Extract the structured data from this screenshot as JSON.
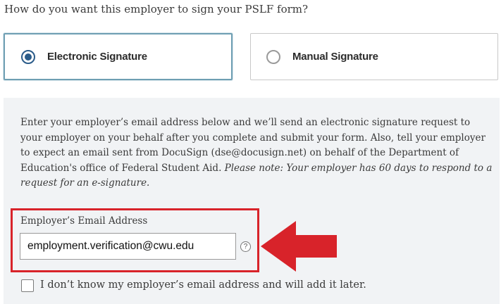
{
  "question": "How do you want this employer to sign your PSLF form?",
  "signature_options": [
    {
      "label": "Electronic Signature",
      "selected": true
    },
    {
      "label": "Manual Signature",
      "selected": false
    }
  ],
  "instructions": {
    "text": "Enter your employer’s email address below and we’ll send an electronic signature request to your employer on your behalf after you complete and submit your form. Also, tell your employer to expect an email sent from DocuSign (dse@docusign.net) on behalf of the Department of Education's office of Federal Student Aid. ",
    "note": "Please note: Your employer has 60 days to respond to a request for an e-signature."
  },
  "email_field": {
    "label": "Employer’s Email Address",
    "value": "employment.verification@cwu.edu",
    "help_glyph": "?"
  },
  "no_email_checkbox": {
    "label": "I don’t know my employer’s email address and will add it later.",
    "checked": false
  },
  "colors": {
    "highlight_red": "#d8232a",
    "selected_border": "#6f9fb3",
    "radio_blue": "#2b5c8a",
    "panel_bg": "#f1f3f5"
  },
  "icons": [
    "radio-selected-icon",
    "radio-unselected-icon",
    "help-icon",
    "red-arrow-icon"
  ]
}
